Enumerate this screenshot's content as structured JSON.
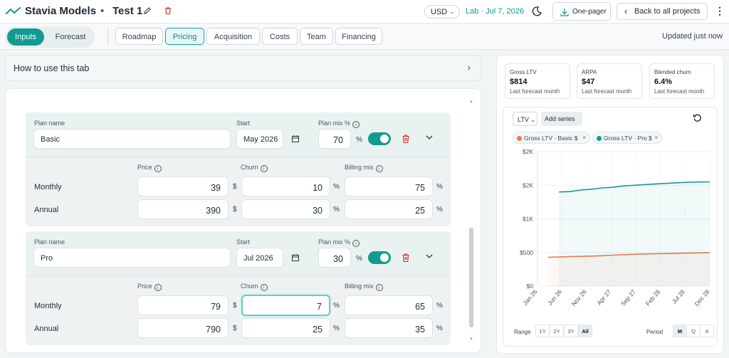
{
  "header": {
    "app_title": "Stavia Models",
    "separator": "•",
    "project_name": "Test 1",
    "currency": "USD",
    "lab_date": "Lab · Jul 7, 2026",
    "onepager_label": "One-pager",
    "back_label": "Back to all projects",
    "kebab": "⋮"
  },
  "subnav": {
    "mode_tabs": [
      {
        "label": "Inputs"
      },
      {
        "label": "Forecast"
      }
    ],
    "tabs": [
      {
        "label": "Roadmap"
      },
      {
        "label": "Pricing"
      },
      {
        "label": "Acquisition"
      },
      {
        "label": "Costs"
      },
      {
        "label": "Team"
      },
      {
        "label": "Financing"
      }
    ],
    "updated": "Updated just now"
  },
  "howto": {
    "label": "How to use this tab"
  },
  "plan_labels": {
    "plan_name": "Plan name",
    "start": "Start",
    "plan_mix": "Plan mix %",
    "price": "Price",
    "churn": "Churn",
    "billing_mix": "Billing mix",
    "currency_unit": "$",
    "percent_unit": "%"
  },
  "plans": [
    {
      "name": "Basic",
      "start": "May 2026",
      "plan_mix": "70",
      "rows": [
        {
          "label": "Monthly",
          "price": "39",
          "churn": "10",
          "billing_mix": "75"
        },
        {
          "label": "Annual",
          "price": "390",
          "churn": "30",
          "billing_mix": "25"
        }
      ]
    },
    {
      "name": "Pro",
      "start": "Jul 2026",
      "plan_mix": "30",
      "rows": [
        {
          "label": "Monthly",
          "price": "79",
          "churn": "7",
          "billing_mix": "65"
        },
        {
          "label": "Annual",
          "price": "790",
          "churn": "25",
          "billing_mix": "35"
        }
      ]
    }
  ],
  "kpis": [
    {
      "title": "Gross LTV",
      "value": "$814",
      "sub": "Last forecast month"
    },
    {
      "title": "ARPA",
      "value": "$47",
      "sub": "Last forecast month"
    },
    {
      "title": "Blended churn",
      "value": "6.4%",
      "sub": "Last forecast month"
    }
  ],
  "chart_controls": {
    "metric": "LTV",
    "add_series": "Add series",
    "chips": [
      {
        "label": "Gross LTV · Basic  $",
        "color": "#f07a45"
      },
      {
        "label": "Gross LTV · Pro  $",
        "color": "#129c91"
      }
    ],
    "range_label": "Range",
    "ranges": [
      "1Y",
      "2Y",
      "3Y",
      "All"
    ],
    "active_range": "All",
    "period_label": "Period",
    "periods": [
      "M",
      "Q",
      "A"
    ],
    "active_period": "M"
  },
  "colors": {
    "accent": "#129c91",
    "basic_series": "#f07a45",
    "pro_series": "#129c91",
    "danger": "#dc2626"
  },
  "chart_data": {
    "type": "area",
    "x": [
      "Jun 26",
      "Jul 26",
      "Aug 26",
      "Sep 26",
      "Oct 26",
      "Nov 26",
      "Dec 26",
      "Feb 27",
      "Apr 27",
      "Jun 27",
      "Aug 27",
      "Oct 27",
      "Dec 27",
      "Mar 28",
      "Jun 28",
      "Sep 28",
      "Dec 28"
    ],
    "series": [
      {
        "name": "Gross LTV · Basic",
        "values": [
          null,
          430,
          433,
          438,
          442,
          447,
          452,
          460,
          468,
          473,
          478,
          481,
          484,
          488,
          491,
          494,
          496
        ]
      },
      {
        "name": "Gross LTV · Pro",
        "values": [
          null,
          null,
          1400,
          1405,
          1430,
          1440,
          1460,
          1470,
          1490,
          1500,
          1510,
          1520,
          1528,
          1536,
          1545,
          1548,
          1550
        ]
      }
    ],
    "tick_labels_x": [
      "Jan 26",
      "Jun 26",
      "Nov 26",
      "Apr 27",
      "Sep 27",
      "Feb 28",
      "Jul 28",
      "Dec 28"
    ],
    "tick_labels_y": [
      "$0",
      "$500",
      "$1K",
      "$2K",
      "$2K"
    ],
    "y_ticks": [
      0,
      500,
      1000,
      1500,
      2000
    ],
    "ylim": [
      0,
      2000
    ],
    "grid": true,
    "legend": "top"
  }
}
